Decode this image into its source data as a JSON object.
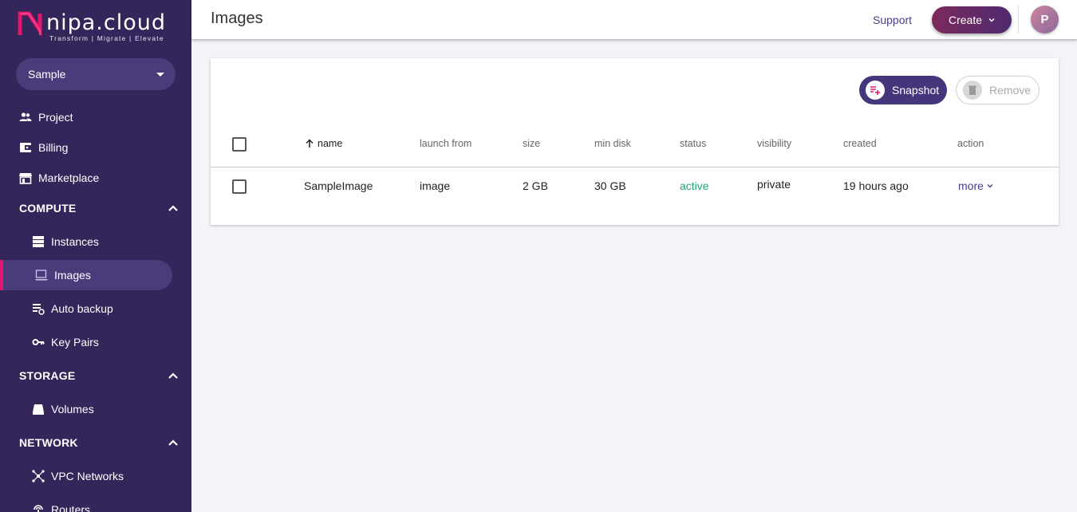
{
  "brand": {
    "name": "nipa.cloud",
    "tagline": "Transform  |  Migrate  |  Elevate",
    "accent": "#e3166f",
    "sidebar_bg": "#34265a"
  },
  "project_selector": {
    "value": "Sample"
  },
  "sidebar": {
    "top_items": [
      {
        "label": "Project",
        "icon": "people-icon"
      },
      {
        "label": "Billing",
        "icon": "wallet-icon"
      },
      {
        "label": "Marketplace",
        "icon": "store-icon"
      }
    ],
    "sections": [
      {
        "title": "COMPUTE",
        "items": [
          {
            "label": "Instances",
            "icon": "server-icon"
          },
          {
            "label": "Images",
            "icon": "monitor-icon",
            "active": true
          },
          {
            "label": "Auto backup",
            "icon": "backup-icon"
          },
          {
            "label": "Key Pairs",
            "icon": "key-icon"
          }
        ]
      },
      {
        "title": "STORAGE",
        "items": [
          {
            "label": "Volumes",
            "icon": "disk-icon"
          }
        ]
      },
      {
        "title": "NETWORK",
        "items": [
          {
            "label": "VPC Networks",
            "icon": "network-icon"
          },
          {
            "label": "Routers",
            "icon": "router-icon"
          }
        ]
      }
    ]
  },
  "header": {
    "title": "Images",
    "support": "Support",
    "create": "Create",
    "avatar_initial": "P"
  },
  "toolbar": {
    "snapshot": "Snapshot",
    "remove": "Remove"
  },
  "table": {
    "columns": [
      "name",
      "launch from",
      "size",
      "min disk",
      "status",
      "visibility",
      "created",
      "action"
    ],
    "rows": [
      {
        "name": "SampleImage",
        "launch_from": "image",
        "size": "2 GB",
        "min_disk": "30 GB",
        "status": "active",
        "visibility": "private",
        "created": "19 hours ago",
        "action": "more"
      }
    ]
  }
}
